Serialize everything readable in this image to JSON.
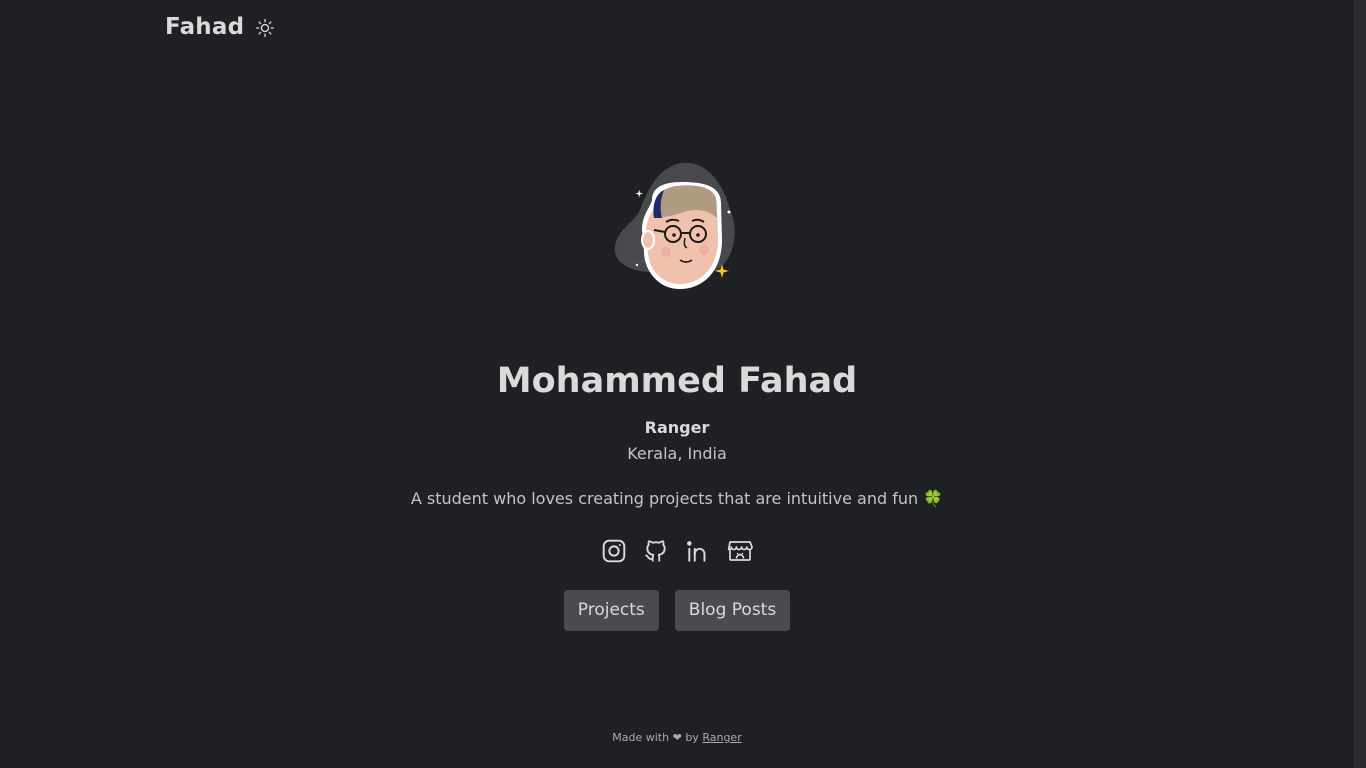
{
  "header": {
    "title": "Fahad",
    "theme_toggle_icon": "sun-icon"
  },
  "profile": {
    "avatar_icon": "memoji-avatar",
    "name": "Mohammed Fahad",
    "tagline": "Ranger",
    "location": "Kerala, India",
    "bio": "A student who loves creating projects that are intuitive and fun",
    "bio_emoji": "🍀"
  },
  "socials": [
    {
      "icon": "instagram-icon"
    },
    {
      "icon": "github-icon"
    },
    {
      "icon": "linkedin-icon"
    },
    {
      "icon": "itchio-icon"
    }
  ],
  "buttons": {
    "projects": "Projects",
    "blog": "Blog Posts"
  },
  "footer": {
    "prefix": "Made with",
    "heart": "❤",
    "by": "by",
    "author_link": "Ranger"
  },
  "colors": {
    "background": "#1f2023",
    "text": "#dadadb",
    "button_bg": "#4a4b4e"
  }
}
